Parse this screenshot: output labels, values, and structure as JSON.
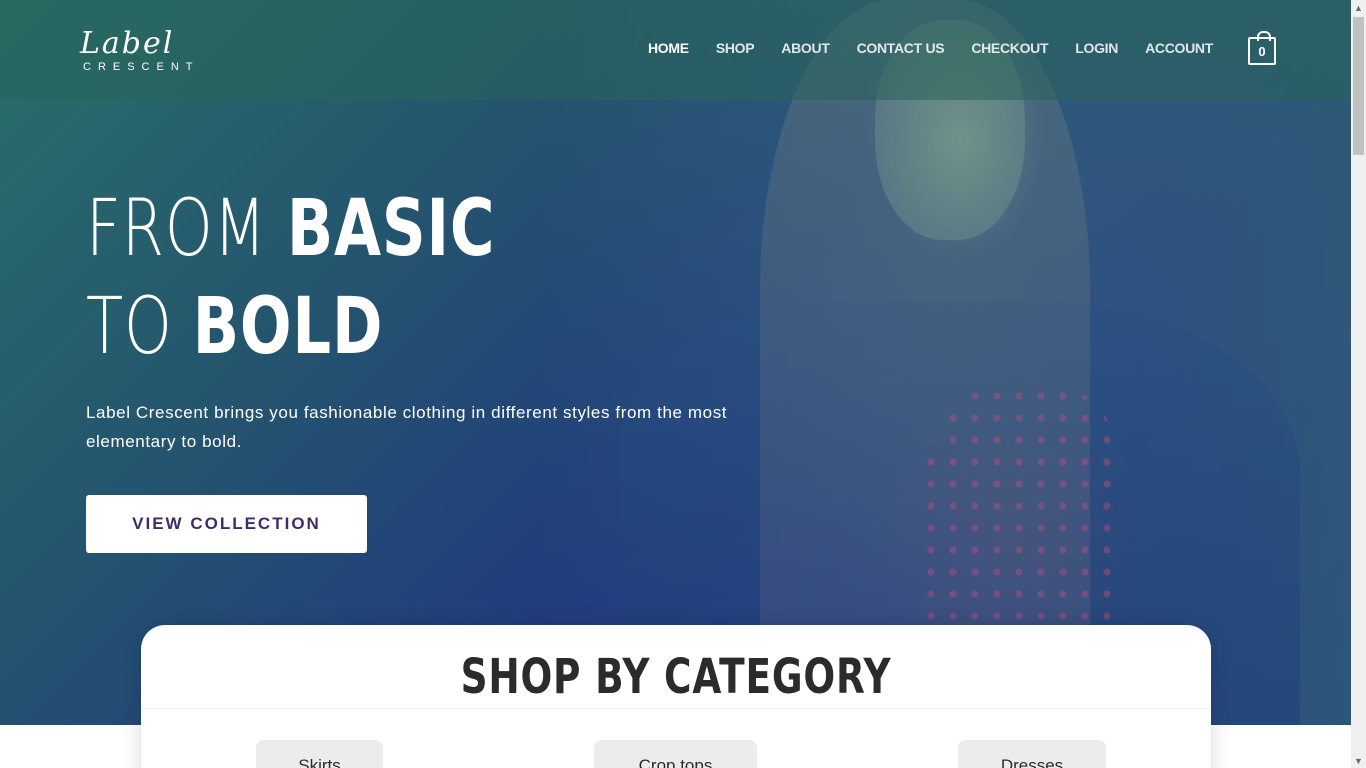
{
  "brand": {
    "logo_script": "Label",
    "logo_sub": "CRESCENT"
  },
  "nav": {
    "items": [
      "HOME",
      "SHOP",
      "ABOUT",
      "CONTACT US",
      "CHECKOUT",
      "LOGIN",
      "ACCOUNT"
    ],
    "active": "HOME",
    "cart_count": "0",
    "cart_icon": "shopping-bag-icon"
  },
  "hero": {
    "title_line1_light": "FROM ",
    "title_line1_bold": "BASIC",
    "title_line2_light": "TO ",
    "title_line2_bold": "BOLD",
    "text": "Label Crescent brings you fashionable clothing in different styles from the most elementary to bold.",
    "button": "VIEW COLLECTION"
  },
  "categories": {
    "title": "SHOP BY CATEGORY",
    "items": [
      "Skirts",
      "Crop tops",
      "Dresses"
    ]
  },
  "colors": {
    "accent": "#3d2d6a",
    "gradient_start": "#2a6f6a",
    "gradient_end": "#1b2a88"
  },
  "scrollbar": {
    "up_icon": "triangle-up-icon",
    "down_icon": "triangle-down-icon"
  }
}
